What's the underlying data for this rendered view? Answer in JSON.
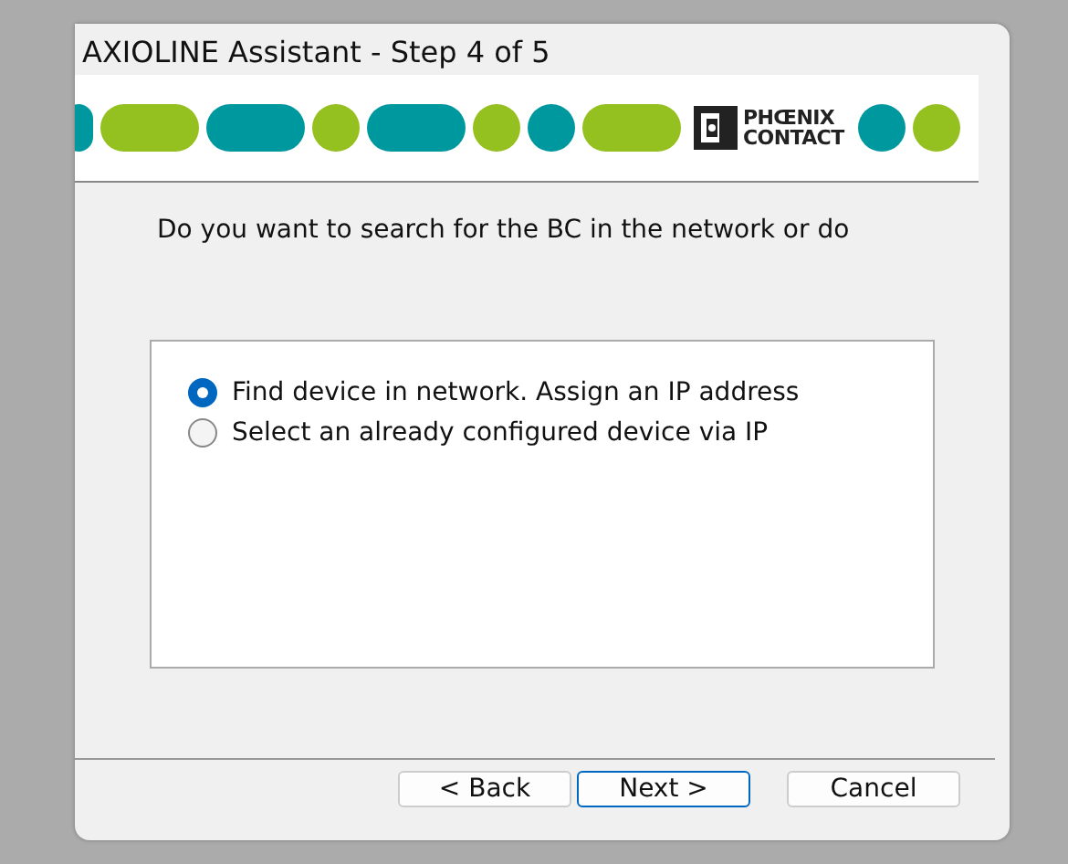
{
  "window": {
    "title": "AXIOLINE Assistant - Step 4 of 5"
  },
  "banner": {
    "logo_line_1": "PHŒNIX",
    "logo_line_2": "CONTACT"
  },
  "question": "Do you want to search for the BC in the network or do",
  "options": [
    {
      "label": "Find device in network. Assign an IP address",
      "selected": true
    },
    {
      "label": "Select an already configured device via IP",
      "selected": false
    }
  ],
  "buttons": [
    {
      "label": "< Back",
      "default": false
    },
    {
      "label": "Next >",
      "default": true
    },
    {
      "label": "Cancel",
      "default": false
    }
  ]
}
